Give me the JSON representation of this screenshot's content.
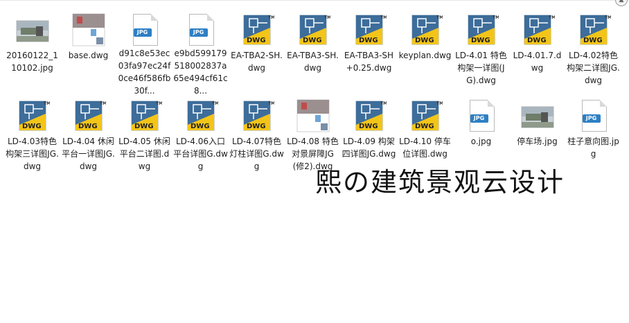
{
  "files_row1": [
    {
      "name": "20160122_110102.jpg",
      "icon": "photo-thumbnail-icon"
    },
    {
      "name": "base.dwg",
      "icon": "dwg-thumbnail-icon"
    },
    {
      "name": "d91c8e53ec03fa97ec24f0ce46f586fb30f...",
      "icon": "jpg-file-icon"
    },
    {
      "name": "e9bd599179518002837a65e494cf61c8...",
      "icon": "jpg-file-icon"
    },
    {
      "name": "EA-TBA2-SH.dwg",
      "icon": "dwg-file-icon"
    },
    {
      "name": "EA-TBA3-SH.dwg",
      "icon": "dwg-file-icon"
    },
    {
      "name": "EA-TBA3-SH+0.25.dwg",
      "icon": "dwg-file-icon"
    },
    {
      "name": "keyplan.dwg",
      "icon": "dwg-file-icon"
    },
    {
      "name": "LD-4.01 特色构架一详图(JG).dwg",
      "icon": "dwg-file-icon"
    },
    {
      "name": "LD-4.01.7.dwg",
      "icon": "dwg-file-icon"
    },
    {
      "name": "LD-4.02特色构架二详图JG.dwg",
      "icon": "dwg-file-icon"
    }
  ],
  "files_row2": [
    {
      "name": "LD-4.03特色构架三详图JG.dwg",
      "icon": "dwg-file-icon"
    },
    {
      "name": "LD-4.04 休闲平台一详图JG.dwg",
      "icon": "dwg-file-icon"
    },
    {
      "name": "LD-4.05 休闲平台二详图.dwg",
      "icon": "dwg-file-icon"
    },
    {
      "name": "LD-4.06入口平台详图G.dwg",
      "icon": "dwg-file-icon"
    },
    {
      "name": "LD-4.07特色灯柱详图G.dwg",
      "icon": "dwg-file-icon"
    },
    {
      "name": "LD-4.08 特色对景屏障JG (修2).dwg",
      "icon": "dwg-thumbnail-icon"
    },
    {
      "name": "LD-4.09 构架四详图JG.dwg",
      "icon": "dwg-file-icon"
    },
    {
      "name": "LD-4.10 停车位详图.dwg",
      "icon": "dwg-file-icon"
    },
    {
      "name": "o.jpg",
      "icon": "jpg-file-icon"
    },
    {
      "name": "停车场.jpg",
      "icon": "photo-thumbnail-icon"
    },
    {
      "name": "柱子意向图.jpg",
      "icon": "jpg-file-icon"
    }
  ],
  "labels": {
    "dwg": "DWG",
    "jpg": "JPG",
    "tm": "TM"
  },
  "watermark": "熙の建筑景观云设计",
  "colors": {
    "dwg_blue": "#3d6d9a",
    "dwg_yellow": "#f3c519",
    "jpg_blue": "#2e7fc4",
    "selection_text": "#1e1e1e"
  }
}
